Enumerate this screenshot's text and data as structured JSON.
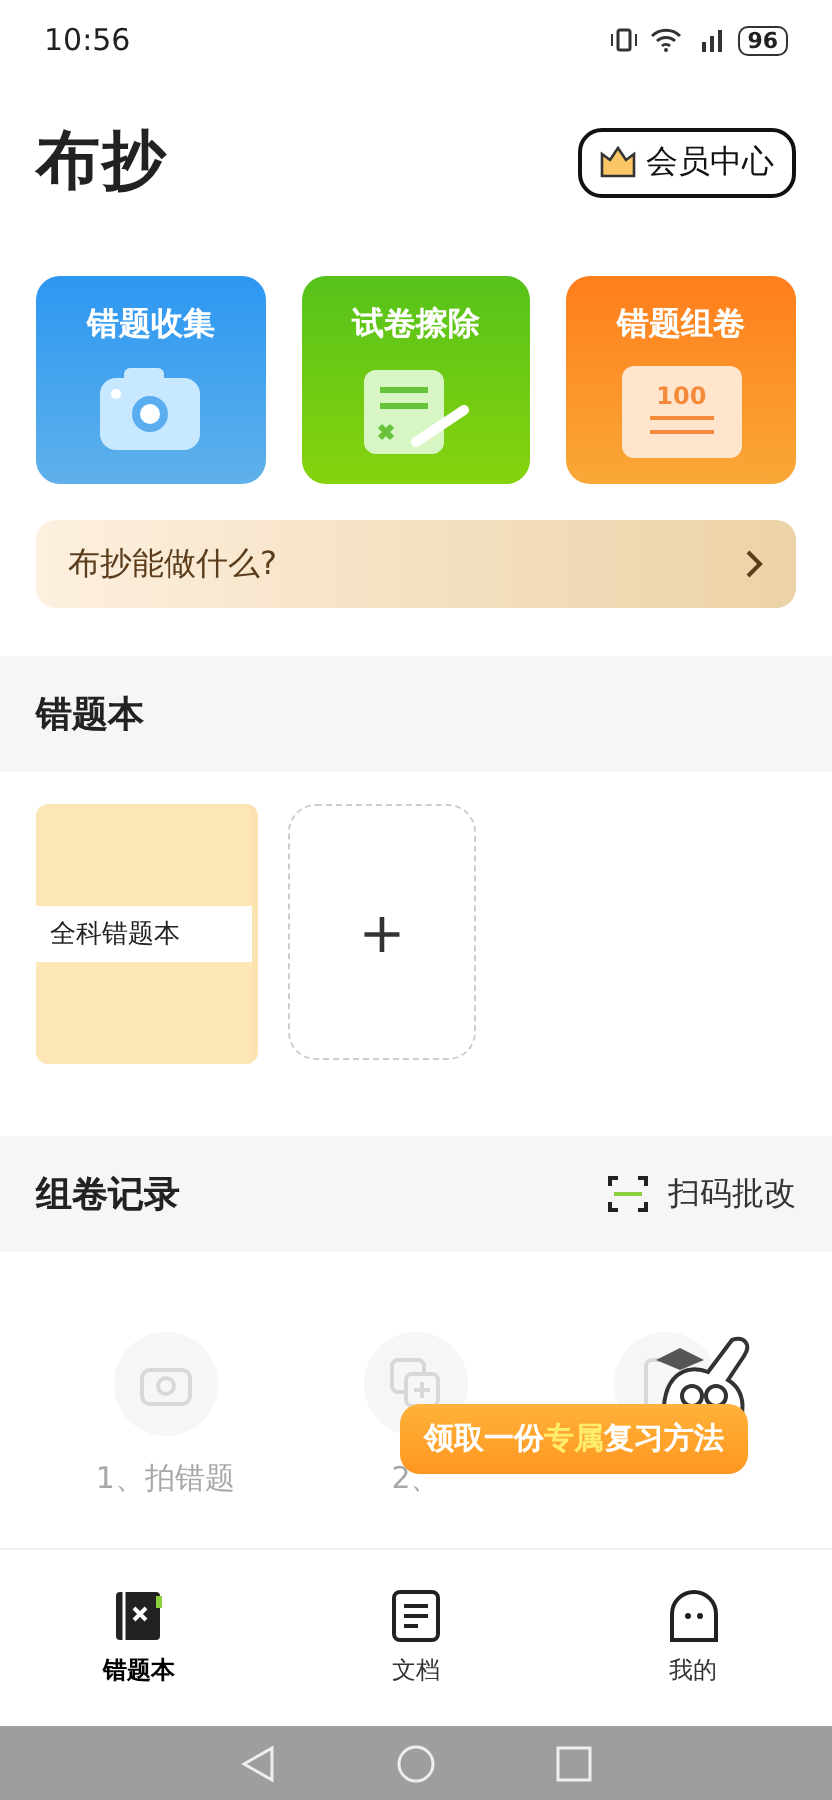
{
  "status_bar": {
    "time": "10:56",
    "battery": "96"
  },
  "header": {
    "logo": "布抄",
    "vip_button": "会员中心"
  },
  "features": [
    {
      "kind": "camera",
      "label": "错题收集"
    },
    {
      "kind": "eraser",
      "label": "试卷擦除"
    },
    {
      "kind": "paper",
      "label": "错题组卷",
      "icon_text": "100"
    }
  ],
  "intro_banner": {
    "label": "布抄能做什么?"
  },
  "notebook_section": {
    "title": "错题本",
    "notebooks": [
      {
        "name": "全科错题本"
      }
    ],
    "add_label": "+"
  },
  "records_section": {
    "title": "组卷记录",
    "scan_label": "扫码批改",
    "steps": [
      {
        "kind": "camera",
        "label": "1、拍错题"
      },
      {
        "kind": "combine",
        "label": "2、"
      },
      {
        "kind": "doc"
      }
    ]
  },
  "promo": {
    "before": "领取一份",
    "highlight": "专属",
    "after": "复习方法"
  },
  "bottom_tabs": [
    {
      "kind": "notebook",
      "label": "错题本",
      "selected": true
    },
    {
      "kind": "doc",
      "label": "文档",
      "selected": false
    },
    {
      "kind": "me",
      "label": "我的",
      "selected": false
    }
  ]
}
